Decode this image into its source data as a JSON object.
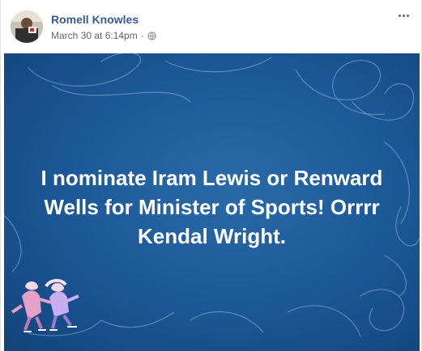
{
  "post": {
    "author_name": "Romell Knowles",
    "timestamp": "March 30 at 6:14pm",
    "separator": "·",
    "privacy_icon": "globe-icon",
    "menu_icon": "more-options-icon",
    "status_text": "I nominate Iram Lewis or Renward Wells for Minister of Sports! Orrrr Kendal Wright.",
    "background": {
      "theme": "ice-skating",
      "primary_color": "#1e5a99",
      "text_color": "#ffffff"
    }
  }
}
